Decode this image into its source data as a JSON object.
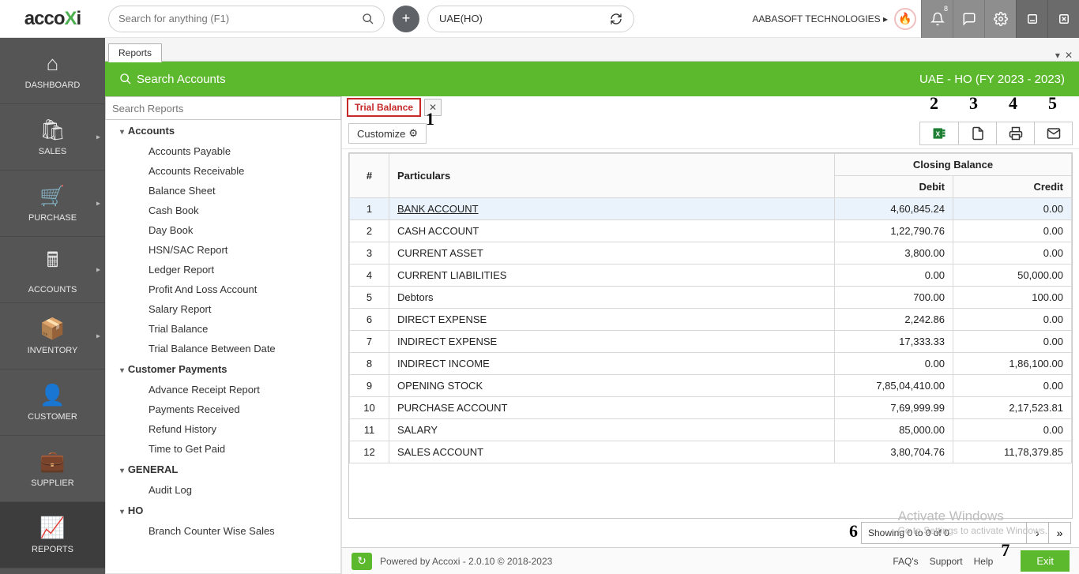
{
  "brand": {
    "pre": "acco",
    "accent": "X",
    "post": "i"
  },
  "search_placeholder": "Search for anything (F1)",
  "org": "UAE(HO)",
  "company": "AABASOFT TECHNOLOGIES",
  "notif_count": "8",
  "nav": [
    {
      "label": "DASHBOARD",
      "chev": false
    },
    {
      "label": "SALES",
      "chev": true
    },
    {
      "label": "PURCHASE",
      "chev": true
    },
    {
      "label": "ACCOUNTS",
      "chev": true
    },
    {
      "label": "INVENTORY",
      "chev": true
    },
    {
      "label": "CUSTOMER",
      "chev": false
    },
    {
      "label": "SUPPLIER",
      "chev": false
    },
    {
      "label": "REPORTS",
      "chev": false
    }
  ],
  "doc_tab": "Reports",
  "greenbar": {
    "title": "Search Accounts",
    "fy": "UAE - HO (FY 2023 - 2023)"
  },
  "reports_search_placeholder": "Search Reports",
  "tree": [
    {
      "group": "Accounts",
      "items": [
        "Accounts Payable",
        "Accounts Receivable",
        "Balance Sheet",
        "Cash Book",
        "Day Book",
        "HSN/SAC Report",
        "Ledger Report",
        "Profit And Loss Account",
        "Salary Report",
        "Trial Balance",
        "Trial Balance Between Date"
      ]
    },
    {
      "group": "Customer Payments",
      "items": [
        "Advance Receipt Report",
        "Payments Received",
        "Refund History",
        "Time to Get Paid"
      ]
    },
    {
      "group": "GENERAL",
      "items": [
        "Audit Log"
      ]
    },
    {
      "group": "HO",
      "items": [
        "Branch Counter Wise Sales"
      ]
    }
  ],
  "inner_tab": "Trial Balance",
  "customize": "Customize",
  "anno": {
    "1": "1",
    "2": "2",
    "3": "3",
    "4": "4",
    "5": "5",
    "6": "6",
    "7": "7"
  },
  "table": {
    "group_header": "Closing Balance",
    "cols": {
      "num": "#",
      "part": "Particulars",
      "debit": "Debit",
      "credit": "Credit"
    },
    "rows": [
      {
        "n": "1",
        "p": "BANK ACCOUNT",
        "d": "4,60,845.24",
        "c": "0.00",
        "link": true,
        "sel": true
      },
      {
        "n": "2",
        "p": "CASH ACCOUNT",
        "d": "1,22,790.76",
        "c": "0.00"
      },
      {
        "n": "3",
        "p": "CURRENT ASSET",
        "d": "3,800.00",
        "c": "0.00"
      },
      {
        "n": "4",
        "p": "CURRENT LIABILITIES",
        "d": "0.00",
        "c": "50,000.00"
      },
      {
        "n": "5",
        "p": "Debtors",
        "d": "700.00",
        "c": "100.00"
      },
      {
        "n": "6",
        "p": "DIRECT EXPENSE",
        "d": "2,242.86",
        "c": "0.00"
      },
      {
        "n": "7",
        "p": "INDIRECT EXPENSE",
        "d": "17,333.33",
        "c": "0.00"
      },
      {
        "n": "8",
        "p": "INDIRECT INCOME",
        "d": "0.00",
        "c": "1,86,100.00"
      },
      {
        "n": "9",
        "p": "OPENING STOCK",
        "d": "7,85,04,410.00",
        "c": "0.00"
      },
      {
        "n": "10",
        "p": "PURCHASE ACCOUNT",
        "d": "7,69,999.99",
        "c": "2,17,523.81"
      },
      {
        "n": "11",
        "p": "SALARY",
        "d": "85,000.00",
        "c": "0.00"
      },
      {
        "n": "12",
        "p": "SALES ACCOUNT",
        "d": "3,80,704.76",
        "c": "11,78,379.85"
      }
    ]
  },
  "pager": "Showing 0 to 0 of 0",
  "watermark": {
    "t": "Activate Windows",
    "s": "Go to Settings to activate Windows."
  },
  "footer": {
    "powered": "Powered by Accoxi - 2.0.10 © 2018-2023",
    "links": [
      "FAQ's",
      "Support",
      "Help"
    ],
    "exit": "Exit"
  }
}
